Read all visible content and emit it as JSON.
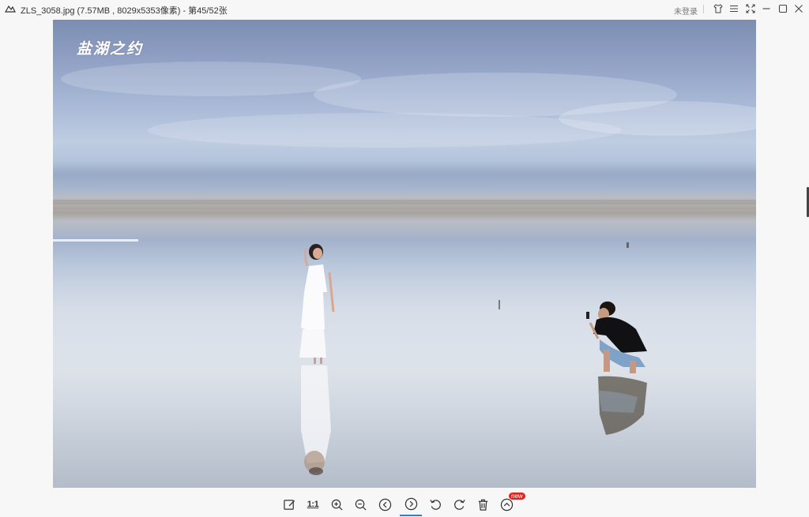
{
  "window": {
    "title": "ZLS_3058.jpg (7.57MB , 8029x5353像素) - 第45/52张",
    "login_label": "未登录",
    "controls": [
      "skin-icon",
      "menu-icon",
      "fullscreen-icon",
      "minimize-icon",
      "maximize-icon",
      "close-icon"
    ]
  },
  "photo": {
    "watermark": "盐湖之约"
  },
  "toolbar": {
    "tools": [
      "edit-icon",
      "actual-size",
      "zoom-in-icon",
      "zoom-out-icon",
      "previous-icon",
      "next-icon",
      "rotate-left-icon",
      "rotate-right-icon",
      "delete-icon",
      "more-icon"
    ],
    "actual_size_label": "1:1",
    "active_tool": "next",
    "new_badge": "new"
  },
  "colors": {
    "accent": "#2b7de0",
    "badge": "#e0221e"
  }
}
